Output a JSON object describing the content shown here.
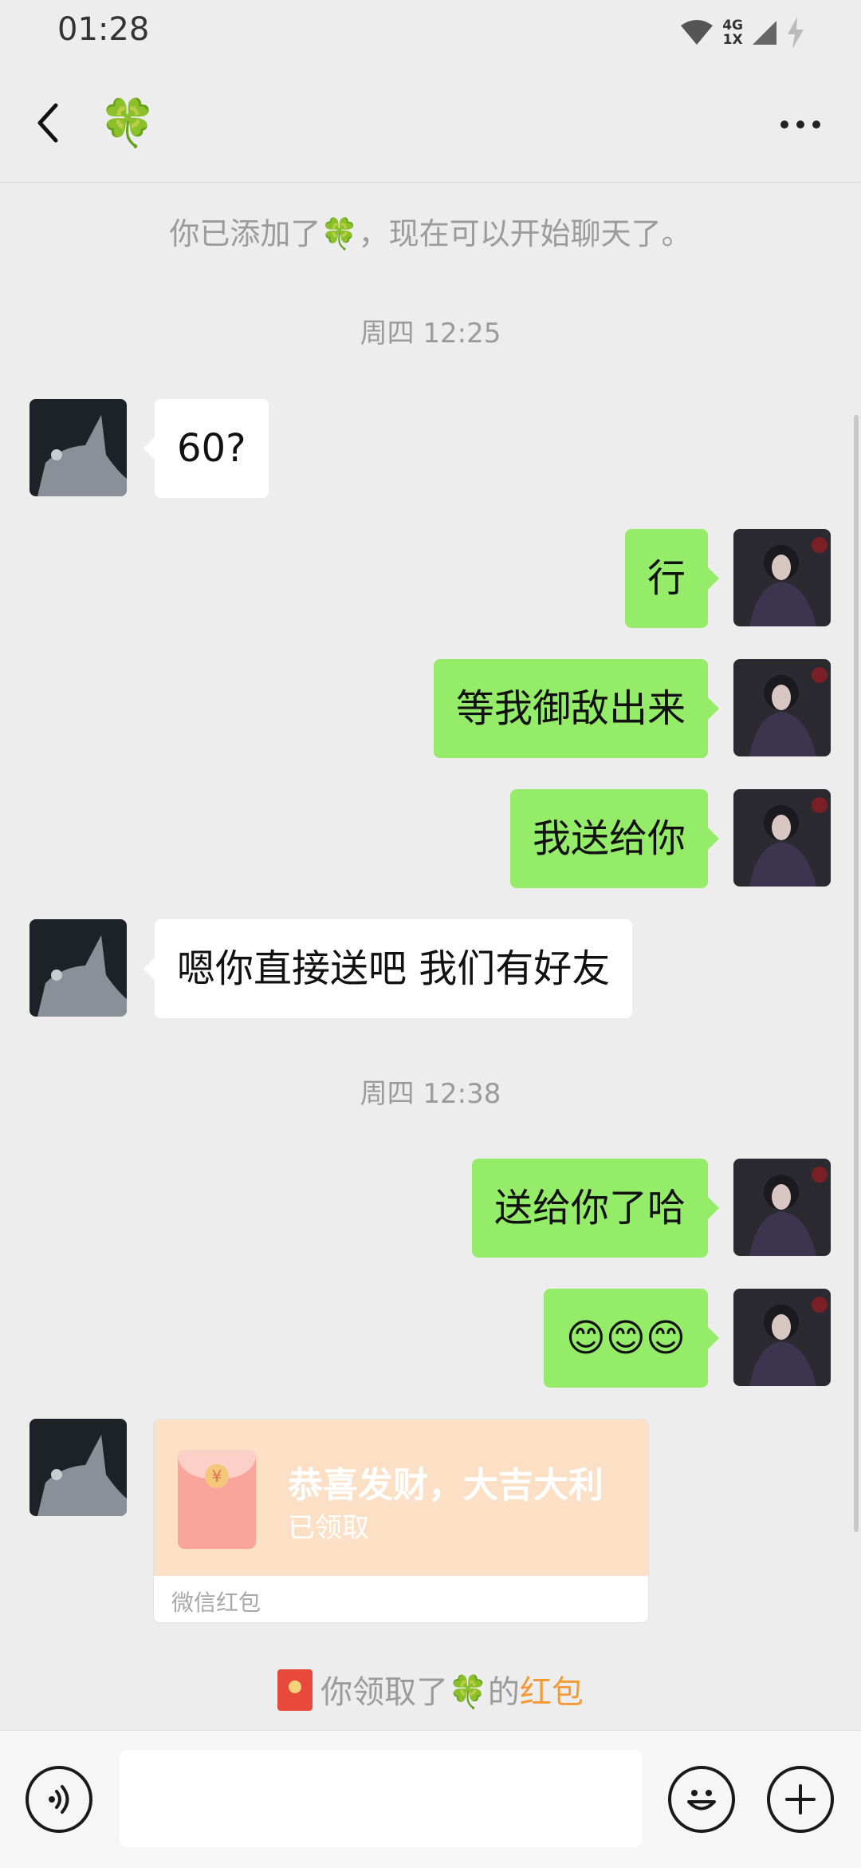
{
  "status_bar": {
    "time": "01:28",
    "network": "4G",
    "network_sub": "1X"
  },
  "header": {
    "contact_name": "🍀"
  },
  "system_message": "你已添加了🍀，现在可以开始聊天了。",
  "time_separators": [
    "周四 12:25",
    "周四 12:38"
  ],
  "messages": [
    {
      "side": "left",
      "text": "60?"
    },
    {
      "side": "right",
      "text": "行"
    },
    {
      "side": "right",
      "text": "等我御敌出来"
    },
    {
      "side": "right",
      "text": "我送给你"
    },
    {
      "side": "left",
      "text": "嗯你直接送吧 我们有好友"
    },
    {
      "side": "right",
      "text": "送给你了哈"
    },
    {
      "side": "right",
      "text": "😊😊😊"
    }
  ],
  "red_packet": {
    "title": "恭喜发财，大吉大利",
    "status": "已领取",
    "footer": "微信红包",
    "coin_symbol": "¥"
  },
  "notice": {
    "prefix": "你领取了🍀的",
    "link": "红包"
  },
  "input": {
    "value": ""
  },
  "colors": {
    "sent_bubble": "#95ec69",
    "received_bubble": "#ffffff",
    "red_packet_bg": "#fbe0c5",
    "link": "#f29b38"
  }
}
